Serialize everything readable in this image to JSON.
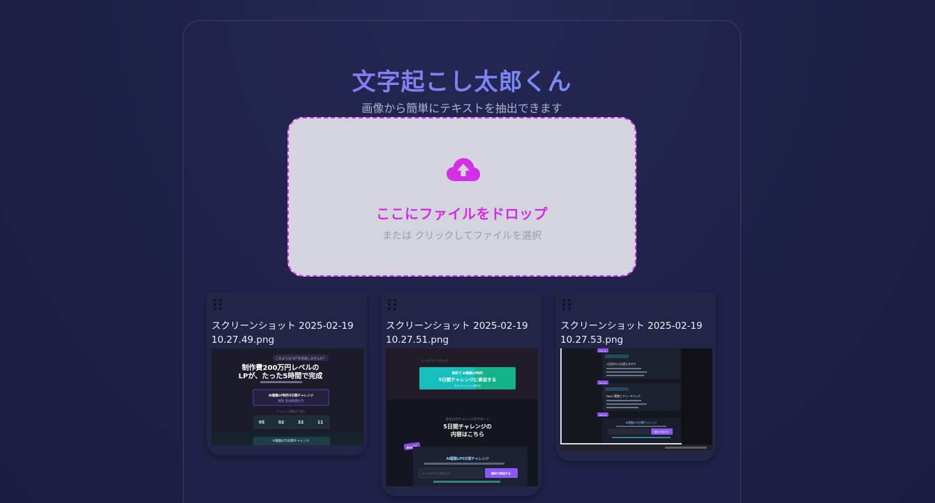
{
  "app": {
    "title": "文字起こし太郎くん",
    "subtitle": "画像から簡単にテキストを抽出できます"
  },
  "dropzone": {
    "icon": "cloud-upload-icon",
    "title": "ここにファイルをドロップ",
    "subtitle": "または クリックしてファイルを選択",
    "accent_color": "#d92ef0"
  },
  "files": [
    {
      "name": "スクリーンショット 2025-02-19 10.27.49.png",
      "thumb": {
        "badge": "このような\"LP\"を作成しませんか？",
        "headline1": "制作費200万円レベルの",
        "headline2": "LPが、たった5時間で完成",
        "box1": "AI駆動LP制作5日間チャレンジ",
        "box2": "特別 参加特典付き",
        "countdown_label": "チャレンジ開始まで残り",
        "countdown": [
          "05",
          "02",
          "32",
          "11"
        ],
        "bottom": "AI駆動LP5日間チャレンジ"
      }
    },
    {
      "name": "スクリーンショット 2025-02-19 10.27.51.png",
      "thumb": {
        "input": "メールアドレスを入力",
        "cta1": "無料で AI駆動LP制作",
        "cta2": "5日間チャレンジに参加する",
        "cta3": "今すぐエントリー受付中",
        "section_small": "あなたのチャレンジをサポート",
        "section1": "5日間チャレンジの",
        "section2": "内容はこちら",
        "tag": "Day 01",
        "box_title": "AI駆動LP5日間チャレンジ",
        "box_input": "メールアドレスを入力",
        "box_button": "無料で参加する"
      }
    },
    {
      "name": "スクリーンショット 2025-02-19 10.27.53.png",
      "thumb": {
        "tags": [
          "DAY 03",
          "DAY 04",
          "DAY 05"
        ],
        "lines": [
          "1日目から2日目にかけて",
          "Day4 実践とフィードバック",
          "さらに深く学ぶ"
        ],
        "box_title": "AI駆動LP5日間チャレンジ",
        "button": "無料で参加する"
      }
    }
  ]
}
